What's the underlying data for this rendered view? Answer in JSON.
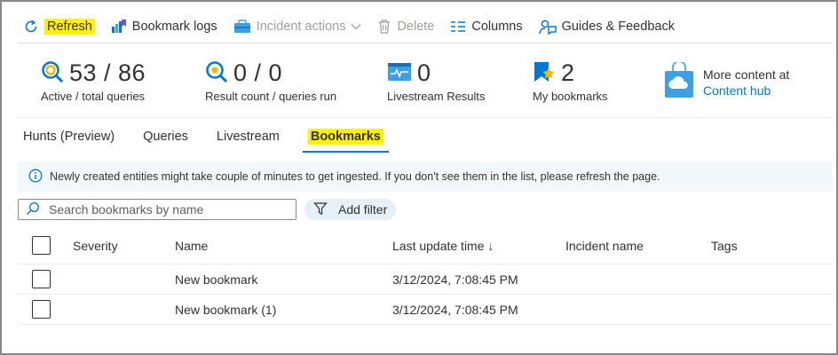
{
  "toolbar": {
    "refresh_label": "Refresh",
    "bookmark_logs_label": "Bookmark logs",
    "incident_actions_label": "Incident actions",
    "delete_label": "Delete",
    "columns_label": "Columns",
    "guides_label": "Guides & Feedback"
  },
  "stats": {
    "queries": {
      "value": "53 / 86",
      "label": "Active / total queries"
    },
    "results": {
      "value": "0 / 0",
      "label": "Result count / queries run"
    },
    "livestream": {
      "value": "0",
      "label": "Livestream Results"
    },
    "bookmarks": {
      "value": "2",
      "label": "My bookmarks"
    },
    "more_content": {
      "line1": "More content at",
      "link": "Content hub"
    }
  },
  "tabs": [
    {
      "label": "Hunts (Preview)"
    },
    {
      "label": "Queries"
    },
    {
      "label": "Livestream"
    },
    {
      "label": "Bookmarks"
    }
  ],
  "info_message": "Newly created entities might take couple of minutes to get ingested. If you don't see them in the list, please refresh the page.",
  "search": {
    "placeholder": "Search bookmarks by name",
    "value": ""
  },
  "add_filter_label": "Add filter",
  "table": {
    "columns": {
      "severity": "Severity",
      "name": "Name",
      "last_update": "Last update time ↓",
      "incident": "Incident name",
      "tags": "Tags"
    },
    "rows": [
      {
        "severity": "",
        "name": "New bookmark",
        "last_update": "3/12/2024, 7:08:45 PM",
        "incident": "",
        "tags": ""
      },
      {
        "severity": "",
        "name": "New bookmark (1)",
        "last_update": "3/12/2024, 7:08:45 PM",
        "incident": "",
        "tags": ""
      }
    ]
  },
  "colors": {
    "accent": "#0078d4",
    "highlight": "#fff100",
    "info_bg": "#f3f8fc"
  },
  "icons": [
    "refresh-icon",
    "bookmark-logs-icon",
    "incident-actions-icon",
    "delete-icon",
    "columns-icon",
    "guides-feedback-icon",
    "queries-icon",
    "results-icon",
    "livestream-icon",
    "bookmarks-icon",
    "content-hub-icon",
    "info-icon",
    "search-icon",
    "filter-icon"
  ]
}
